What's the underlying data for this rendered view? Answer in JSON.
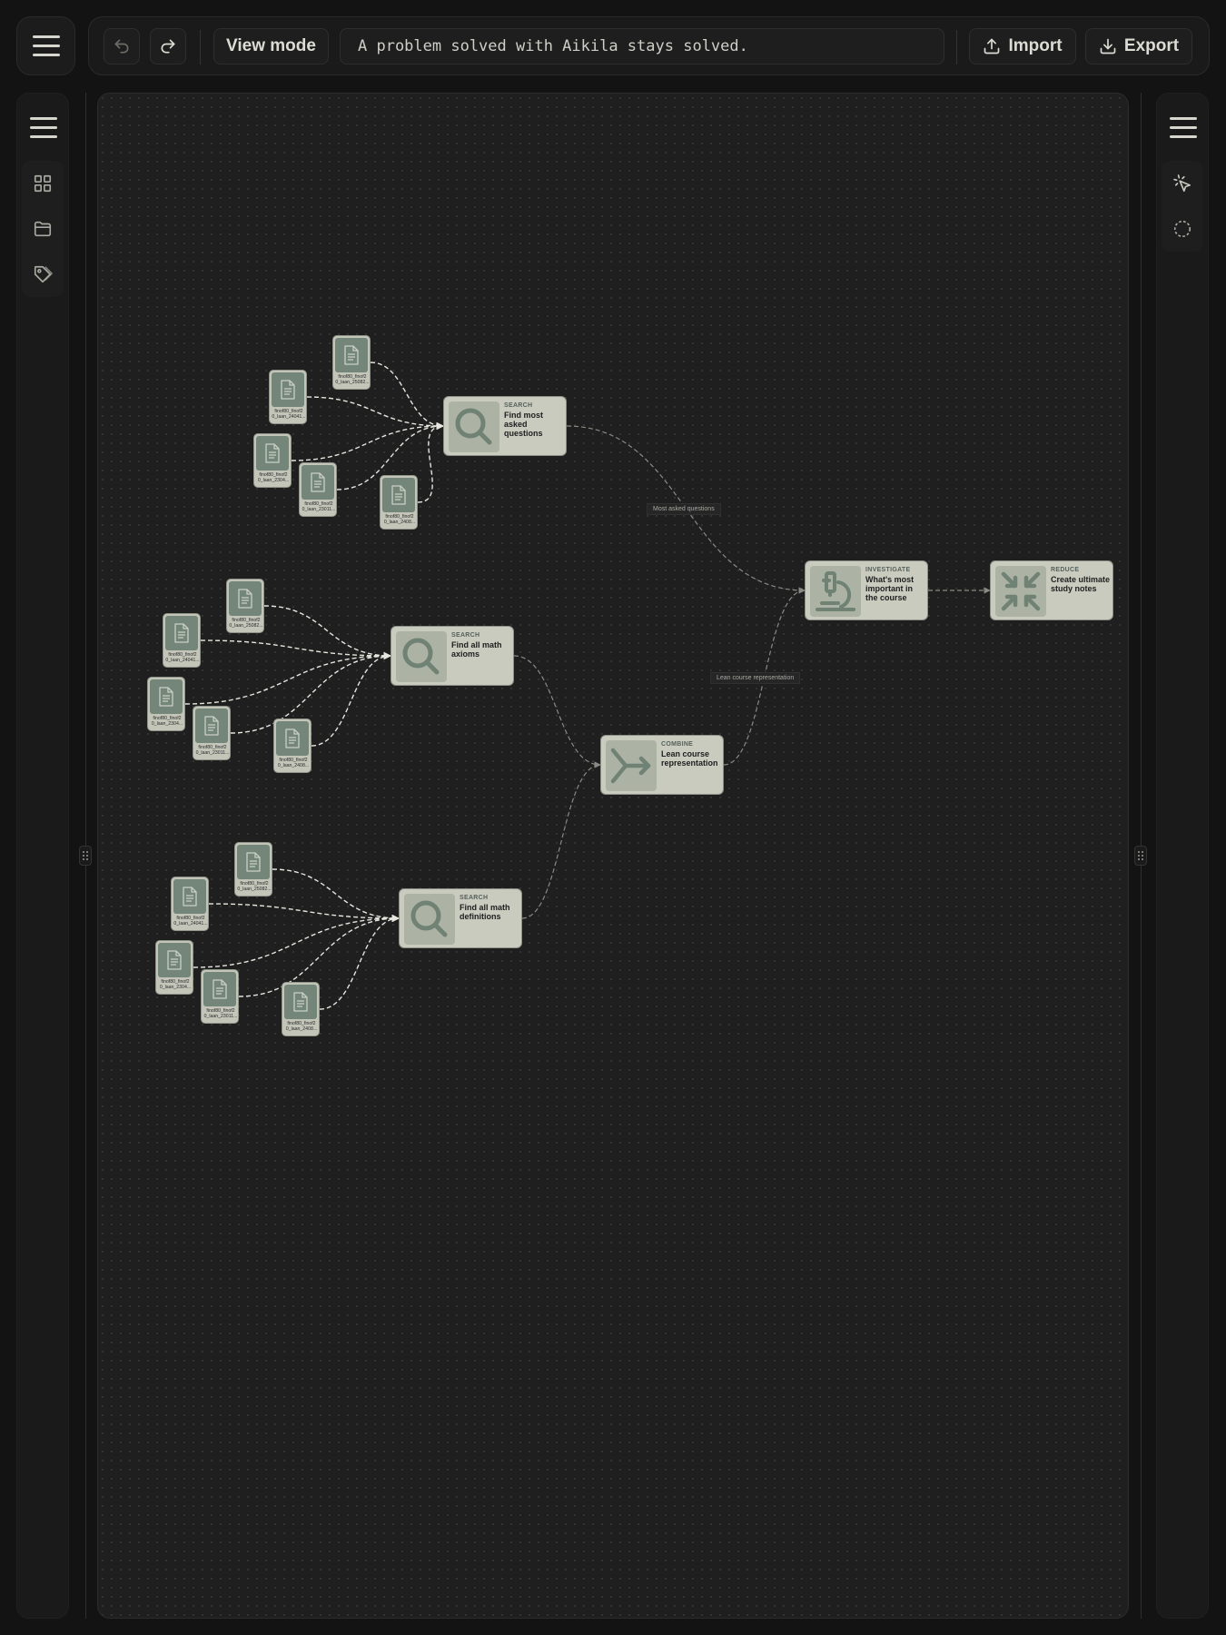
{
  "toolbar": {
    "undo_icon": "undo-icon",
    "redo_icon": "redo-icon",
    "view_mode_label": "View mode",
    "motto": "A problem solved with Aikila stays solved.",
    "import_label": "Import",
    "export_label": "Export"
  },
  "left_sidebar": {
    "items": [
      {
        "icon": "grid-icon"
      },
      {
        "icon": "folder-icon"
      },
      {
        "icon": "tag-icon"
      }
    ]
  },
  "right_sidebar": {
    "items": [
      {
        "icon": "pointer-click-icon"
      },
      {
        "icon": "lasso-circle-icon"
      }
    ]
  },
  "colors": {
    "background": "#131313",
    "canvas": "#1f1f1f",
    "node_fill": "#c9cbbf",
    "node_icon": "#6f8274",
    "edge": "#d8d8d0"
  },
  "graph": {
    "files": [
      {
        "id": "f1",
        "name": "finof80_finof2\n0_laan_25082..."
      },
      {
        "id": "f2",
        "name": "finof80_finof2\n0_laan_24041..."
      },
      {
        "id": "f3",
        "name": "finof80_finof2\n0_laan_2304..."
      },
      {
        "id": "f4",
        "name": "finof80_finof2\n0_laan_23011..."
      },
      {
        "id": "f5",
        "name": "finof80_finof2\n0_laan_2408..."
      },
      {
        "id": "f6",
        "name": "finof80_finof2\n0_laan_25082..."
      },
      {
        "id": "f7",
        "name": "finof80_finof2\n0_laan_24041..."
      },
      {
        "id": "f8",
        "name": "finof80_finof2\n0_laan_2304..."
      },
      {
        "id": "f9",
        "name": "finof80_finof2\n0_laan_23011..."
      },
      {
        "id": "f10",
        "name": "finof80_finof2\n0_laan_2408..."
      },
      {
        "id": "f11",
        "name": "finof80_finof2\n0_laan_25082..."
      },
      {
        "id": "f12",
        "name": "finof80_finof2\n0_laan_24041..."
      },
      {
        "id": "f13",
        "name": "finof80_finof2\n0_laan_2304..."
      },
      {
        "id": "f14",
        "name": "finof80_finof2\n0_laan_23011..."
      },
      {
        "id": "f15",
        "name": "finof80_finof2\n0_laan_2408..."
      }
    ],
    "operations": [
      {
        "id": "s1",
        "kind": "SEARCH",
        "title": "Find most asked questions",
        "icon": "search-icon"
      },
      {
        "id": "s2",
        "kind": "SEARCH",
        "title": "Find all math axioms",
        "icon": "search-icon"
      },
      {
        "id": "s3",
        "kind": "SEARCH",
        "title": "Find all math definitions",
        "icon": "search-icon"
      },
      {
        "id": "c1",
        "kind": "COMBINE",
        "title": "Lean course representation",
        "icon": "merge-icon"
      },
      {
        "id": "i1",
        "kind": "INVESTIGATE",
        "title": "What's most important in the course",
        "icon": "microscope-icon"
      },
      {
        "id": "r1",
        "kind": "REDUCE",
        "title": "Create ultimate study notes",
        "icon": "reduce-arrows-icon"
      }
    ],
    "edges": [
      {
        "from": "f1",
        "to": "s1"
      },
      {
        "from": "f2",
        "to": "s1"
      },
      {
        "from": "f3",
        "to": "s1"
      },
      {
        "from": "f4",
        "to": "s1"
      },
      {
        "from": "f5",
        "to": "s1"
      },
      {
        "from": "f6",
        "to": "s2"
      },
      {
        "from": "f7",
        "to": "s2"
      },
      {
        "from": "f8",
        "to": "s2"
      },
      {
        "from": "f9",
        "to": "s2"
      },
      {
        "from": "f10",
        "to": "s2"
      },
      {
        "from": "f11",
        "to": "s3"
      },
      {
        "from": "f12",
        "to": "s3"
      },
      {
        "from": "f13",
        "to": "s3"
      },
      {
        "from": "f14",
        "to": "s3"
      },
      {
        "from": "f15",
        "to": "s3"
      },
      {
        "from": "s1",
        "to": "i1",
        "label": "Most asked questions"
      },
      {
        "from": "s2",
        "to": "c1"
      },
      {
        "from": "s3",
        "to": "c1"
      },
      {
        "from": "c1",
        "to": "i1",
        "label": "Lean course representation"
      },
      {
        "from": "i1",
        "to": "r1"
      }
    ]
  }
}
